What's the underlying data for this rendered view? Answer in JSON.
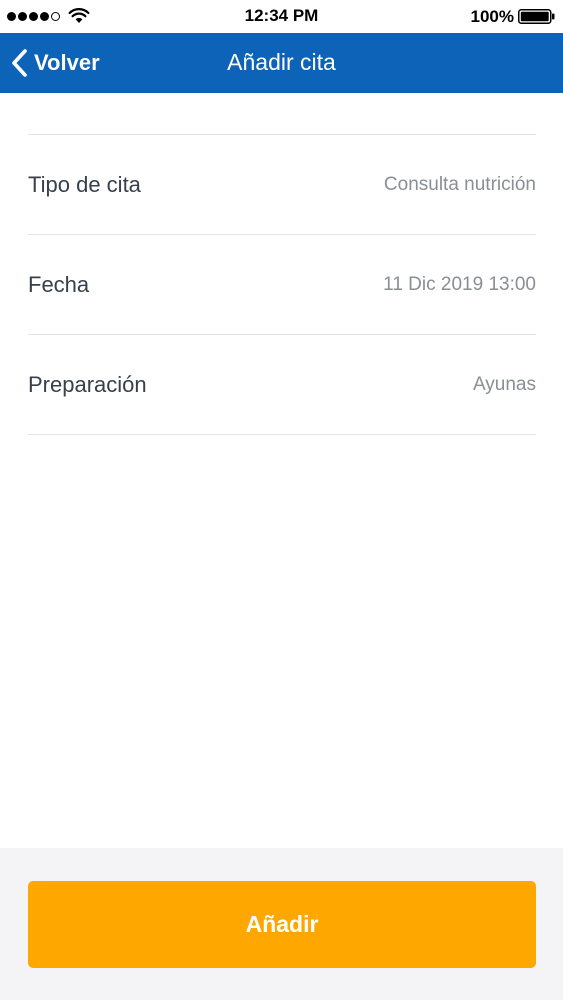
{
  "status_bar": {
    "time": "12:34 PM",
    "battery_percent": "100%",
    "signal_bars_filled": 4,
    "signal_bars_total": 5,
    "icons": [
      "signal-icon",
      "wifi-icon",
      "battery-icon"
    ]
  },
  "nav": {
    "back_label": "Volver",
    "title": "Añadir cita",
    "back_icon": "chevron-left-icon",
    "color": "#0d63b8"
  },
  "form": {
    "rows": [
      {
        "label": "Tipo de cita",
        "value": "Consulta nutrición"
      },
      {
        "label": "Fecha",
        "value": "11 Dic 2019 13:00"
      },
      {
        "label": "Preparación",
        "value": "Ayunas"
      }
    ]
  },
  "footer": {
    "add_label": "Añadir",
    "button_color": "#ffa701"
  }
}
